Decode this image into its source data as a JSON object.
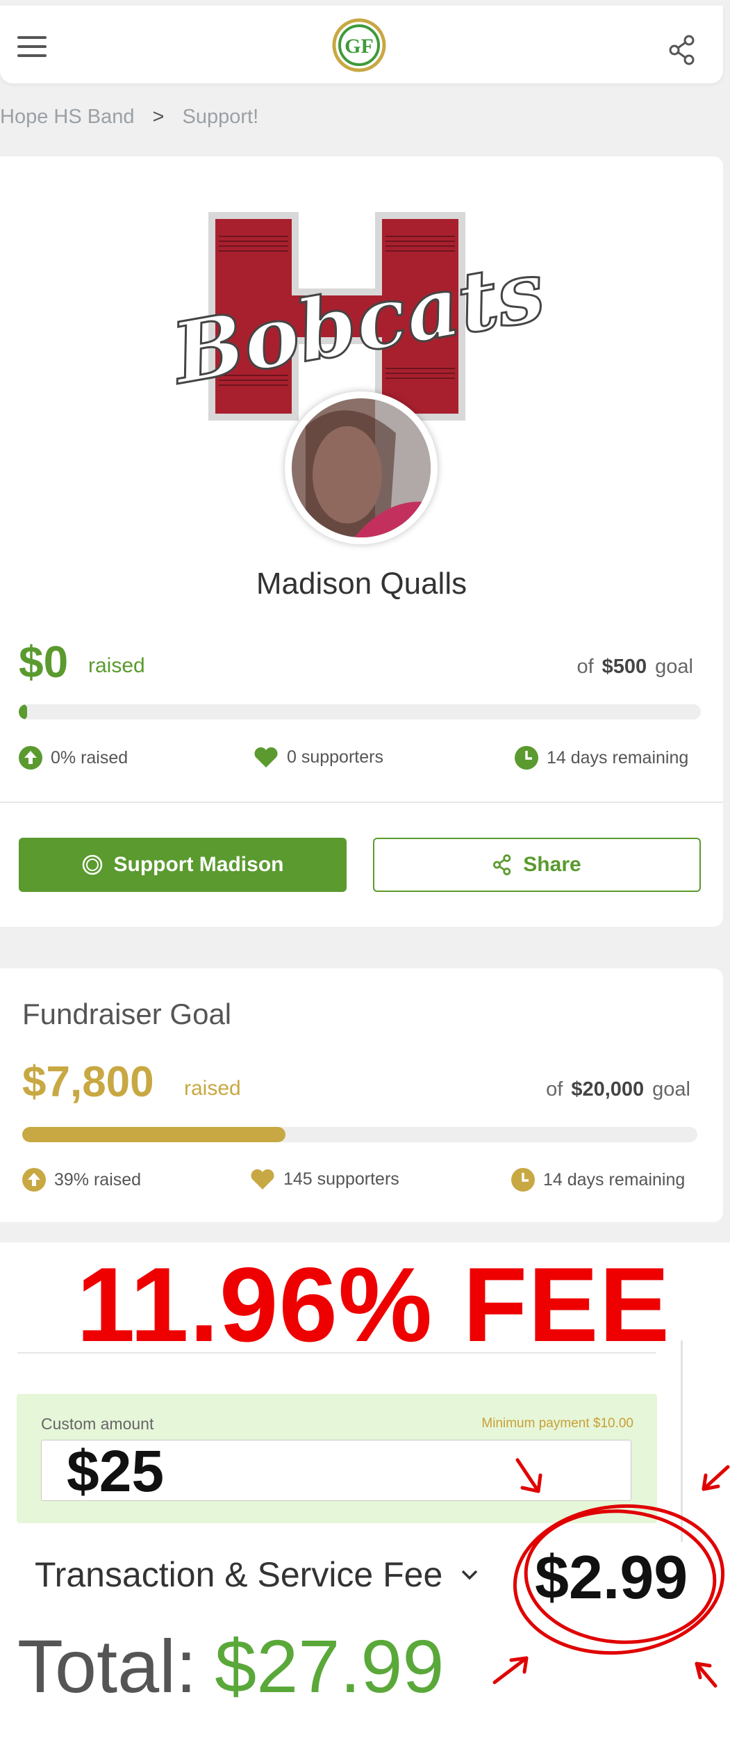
{
  "header": {
    "logo_text": "GF",
    "menu_icon": "hamburger-menu-icon",
    "share_icon": "share-icon"
  },
  "breadcrumb": {
    "items": [
      "Hope HS Band",
      "Support!"
    ],
    "separator": ">"
  },
  "banner": {
    "text": "Bobcats",
    "letter": "H"
  },
  "participant": {
    "name": "Madison Qualls",
    "raised_amount": "$0",
    "raised_label": "raised",
    "goal_prefix": "of",
    "goal_amount": "$500",
    "goal_suffix": "goal",
    "progress_fraction": 0.0,
    "stats": {
      "raised_pct": "0% raised",
      "supporters": "0 supporters",
      "remaining": "14 days remaining"
    },
    "support_button": "Support Madison",
    "share_button": "Share"
  },
  "fundraiser": {
    "title": "Fundraiser Goal",
    "raised_amount": "$7,800",
    "raised_label": "raised",
    "goal_prefix": "of",
    "goal_amount": "$20,000",
    "goal_suffix": "goal",
    "progress_fraction": 0.39,
    "stats": {
      "raised_pct": "39% raised",
      "supporters": "145 supporters",
      "remaining": "14 days remaining"
    }
  },
  "annotation": {
    "headline": "11.96% FEE"
  },
  "payment": {
    "custom_label": "Custom amount",
    "minimum_label": "Minimum payment $10.00",
    "amount_value": "$25",
    "fee_label": "Transaction & Service Fee",
    "fee_value": "$2.99",
    "total_label": "Total:",
    "total_value": "$27.99"
  },
  "colors": {
    "brand_green": "#5a9a2e",
    "gold": "#c8a843",
    "annotation_red": "#ee0000"
  }
}
